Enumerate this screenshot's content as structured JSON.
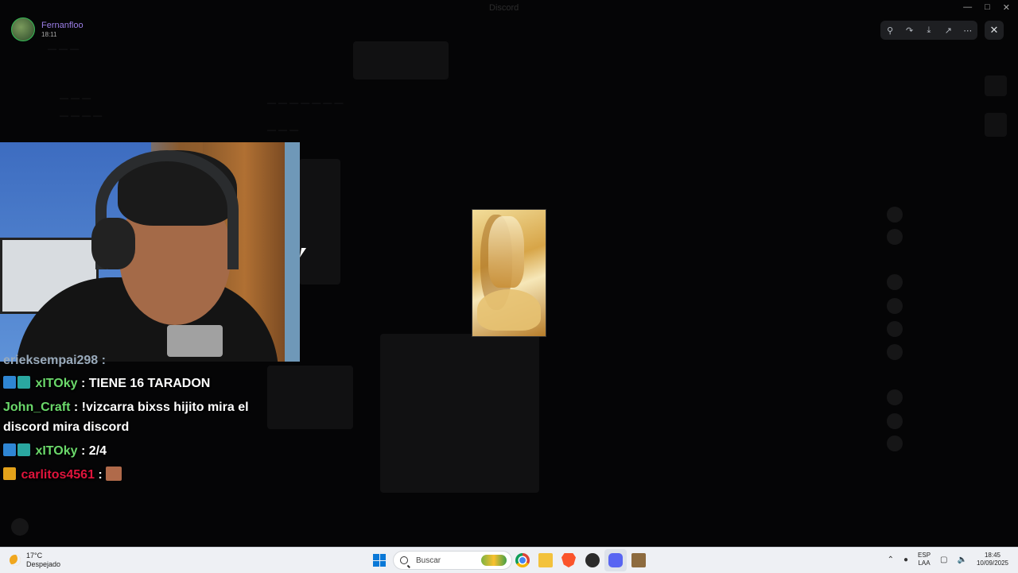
{
  "window": {
    "title": "Discord"
  },
  "viewer_user": {
    "name": "Fernanfloo",
    "time": "18:11"
  },
  "toolbar": {
    "zoom_label": "Zoom",
    "forward_label": "Forward",
    "download_label": "Download",
    "open_label": "Open",
    "more_label": "More",
    "close_label": "Close"
  },
  "chat": {
    "partial_line": "erieksempai298 :",
    "messages": [
      {
        "user": "xITOky",
        "user_color": "#6bd96b",
        "text": "TIENE 16 TARADON",
        "badges": [
          "twitch",
          "prime"
        ]
      },
      {
        "user": "John_Craft",
        "user_color": "#6bd96b",
        "text": "!vizcarra bixss hijito mira el discord mira discord",
        "badges": []
      },
      {
        "user": "xITOky",
        "user_color": "#6bd96b",
        "text": "2/4",
        "badges": [
          "twitch",
          "prime"
        ]
      },
      {
        "user": "carlitos4561",
        "user_color": "#e0143c",
        "text": "",
        "badges": [
          "crown"
        ],
        "emote": true
      }
    ]
  },
  "taskbar": {
    "weather_temp": "17°C",
    "weather_desc": "Despejado",
    "search_placeholder": "Buscar",
    "lang_top": "ESP",
    "lang_bottom": "LAA",
    "clock_time": "18:45",
    "clock_date": "10/09/2025"
  },
  "colors": {
    "accent": "#5865f2",
    "toolbar_bg": "#1e1f22",
    "taskbar_bg": "#eef0f4"
  }
}
